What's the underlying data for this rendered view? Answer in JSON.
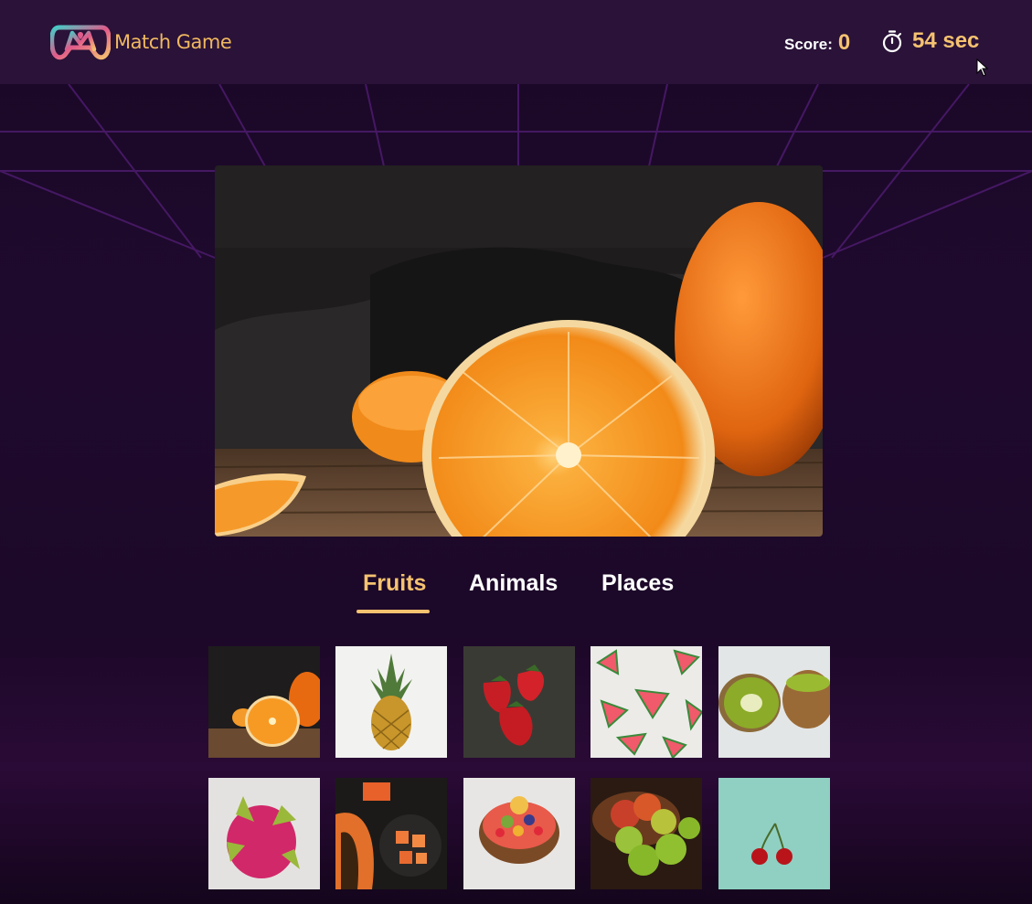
{
  "app": {
    "name": "Match Game"
  },
  "header": {
    "score_label": "Score:",
    "score_value": "0",
    "timer_value": "54 sec"
  },
  "hero": {
    "subject": "orange"
  },
  "tabs": [
    {
      "label": "Fruits",
      "active": true
    },
    {
      "label": "Animals",
      "active": false
    },
    {
      "label": "Places",
      "active": false
    }
  ],
  "thumbnails": [
    {
      "subject": "orange"
    },
    {
      "subject": "pineapple"
    },
    {
      "subject": "strawberry"
    },
    {
      "subject": "watermelon"
    },
    {
      "subject": "kiwi"
    },
    {
      "subject": "dragon-fruit"
    },
    {
      "subject": "papaya"
    },
    {
      "subject": "fruit-bowl"
    },
    {
      "subject": "apple"
    },
    {
      "subject": "cherry"
    }
  ],
  "colors": {
    "accent": "#f5c270",
    "header_bg": "#2a1238",
    "page_bg": "#1f0a2e"
  },
  "icons": [
    "gamepad-logo-icon",
    "stopwatch-icon",
    "mouse-pointer-icon"
  ]
}
